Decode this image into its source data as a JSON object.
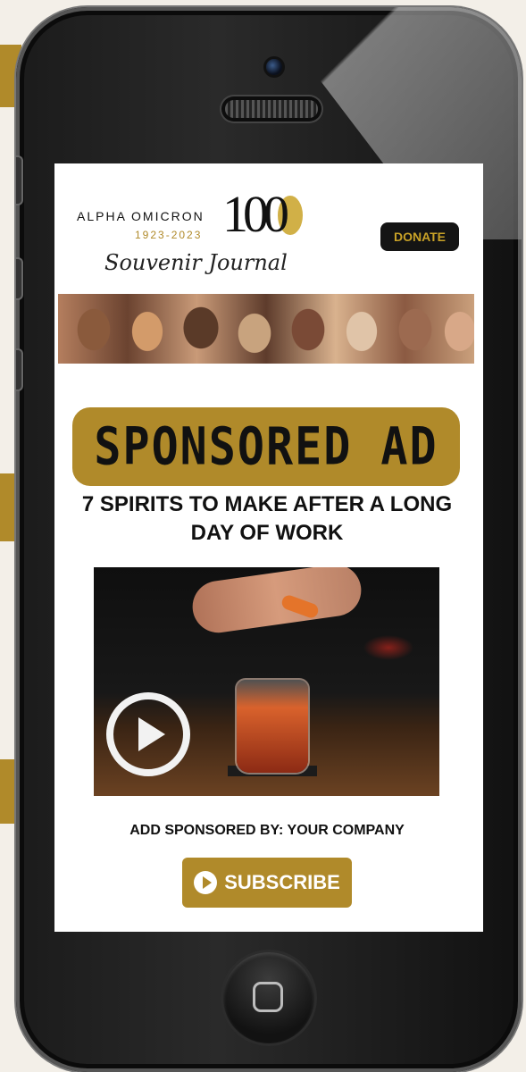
{
  "header": {
    "org_name": "ALPHA OMICRON",
    "years": "1923-2023",
    "anniversary": "100",
    "subtitle": "Souvenir Journal",
    "donate_label": "DONATE"
  },
  "ad": {
    "badge": "SPONSORED AD",
    "headline": "7 SPIRITS TO MAKE AFTER A LONG DAY OF WORK",
    "sponsor": "ADD SPONSORED BY: YOUR COMPANY",
    "subscribe_label": "SUBSCRIBE"
  },
  "colors": {
    "accent": "#b08a2a",
    "donate_bg": "#141414",
    "page_bg": "#ffffff"
  },
  "icons": [
    "play-icon",
    "subscribe-play-icon",
    "home-button-icon"
  ]
}
